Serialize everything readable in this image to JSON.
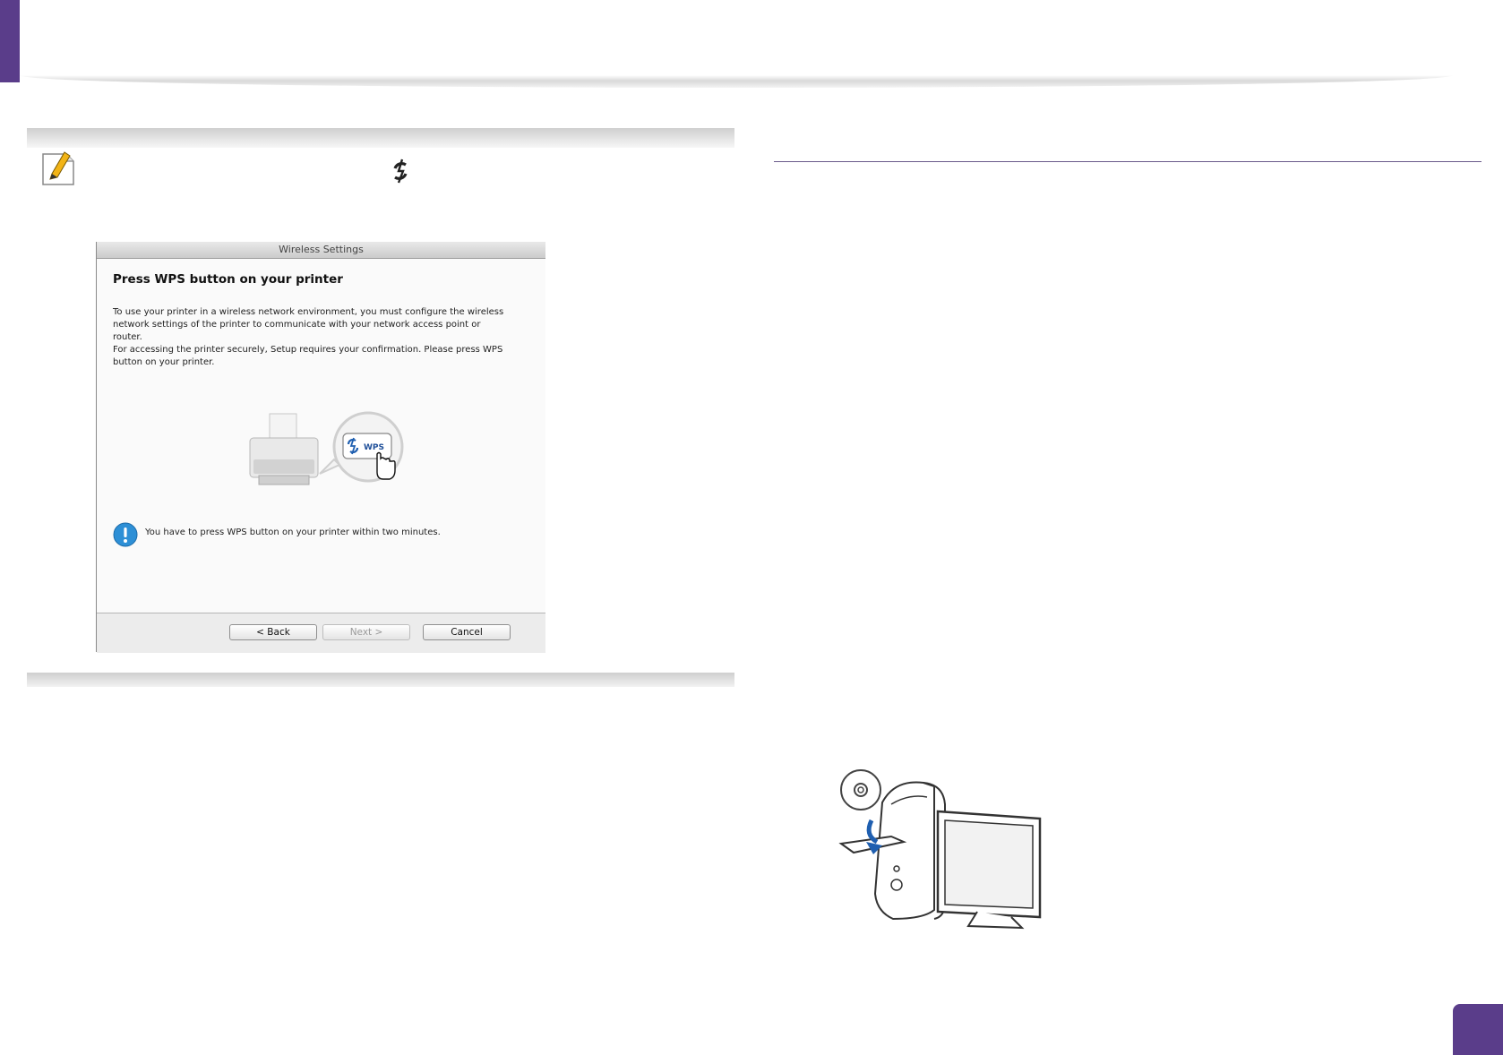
{
  "dialog": {
    "window_title": "Wireless Settings",
    "heading": "Press WPS button on your printer",
    "paragraph_1": "To use your printer in a wireless network environment, you must configure the wireless network settings of the printer to communicate with your network access point or router.",
    "paragraph_2": "For accessing the printer securely, Setup requires your confirmation. Please press WPS button on your printer.",
    "wps_button_label": "WPS",
    "info_text": "You have to press WPS button on your printer within two minutes.",
    "buttons": {
      "back": "< Back",
      "next": "Next >",
      "cancel": "Cancel"
    }
  },
  "colors": {
    "accent": "#5a3d8a",
    "info_blue": "#2d8fd6",
    "wps_blue": "#1f5fb0"
  },
  "icons": [
    "note-pencil-icon",
    "wps-icon",
    "printer-icon",
    "pointer-hand-icon",
    "info-icon",
    "cd-disc-icon",
    "install-arrow-icon"
  ]
}
